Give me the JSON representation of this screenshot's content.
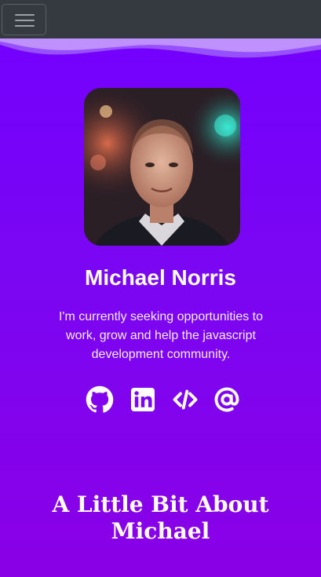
{
  "navbar": {
    "toggle_icon": "hamburger-menu-icon"
  },
  "profile": {
    "photo_alt": "Michael Norris",
    "name": "Michael Norris",
    "bio": "I'm currently seeking opportunities to work, grow and help the javascript development community."
  },
  "social": [
    {
      "icon": "github-icon"
    },
    {
      "icon": "linkedin-icon"
    },
    {
      "icon": "code-icon"
    },
    {
      "icon": "at-sign-icon"
    }
  ],
  "about": {
    "heading": "A Little Bit About Michael"
  },
  "colors": {
    "navbar": "#343a40",
    "background_top": "#7300ff",
    "background_bottom": "#8a00e6",
    "wave": "#b37cff",
    "text": "#ffffff"
  }
}
